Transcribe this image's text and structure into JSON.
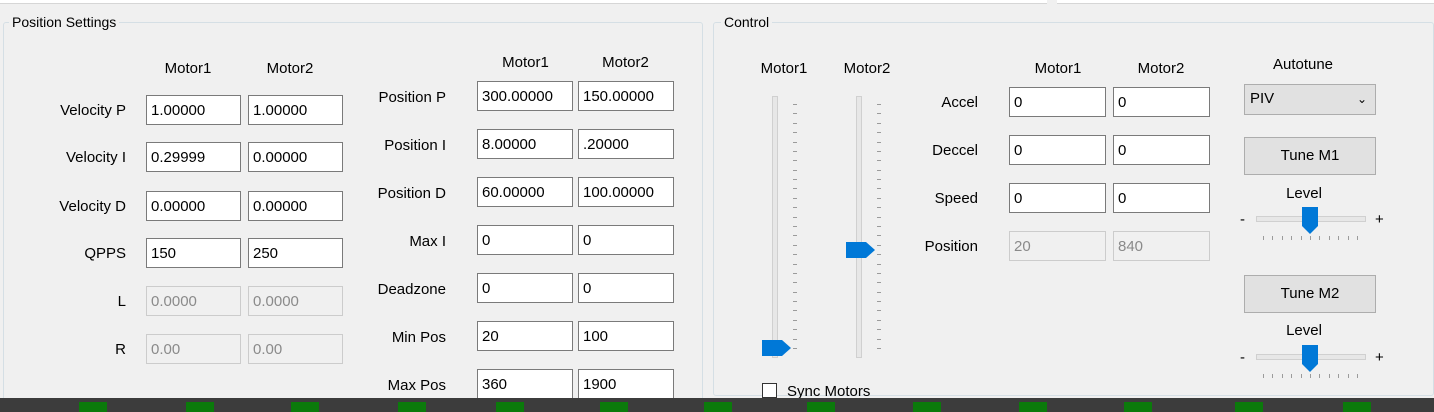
{
  "position_settings": {
    "title": "Position Settings",
    "left_headers": [
      "Motor1",
      "Motor2"
    ],
    "left_rows": [
      {
        "label": "Velocity P",
        "m1": "1.00000",
        "m2": "1.00000",
        "disabled": false
      },
      {
        "label": "Velocity I",
        "m1": "0.29999",
        "m2": "0.00000",
        "disabled": false
      },
      {
        "label": "Velocity D",
        "m1": "0.00000",
        "m2": "0.00000",
        "disabled": false
      },
      {
        "label": "QPPS",
        "m1": "150",
        "m2": "250",
        "disabled": false
      },
      {
        "label": "L",
        "m1": "0.0000",
        "m2": "0.0000",
        "disabled": true
      },
      {
        "label": "R",
        "m1": "0.00",
        "m2": "0.00",
        "disabled": true
      }
    ],
    "right_headers": [
      "Motor1",
      "Motor2"
    ],
    "right_rows": [
      {
        "label": "Position P",
        "m1": "300.00000",
        "m2": "150.00000"
      },
      {
        "label": "Position I",
        "m1": "8.00000",
        "m2": ".20000"
      },
      {
        "label": "Position D",
        "m1": "60.00000",
        "m2": "100.00000"
      },
      {
        "label": "Max I",
        "m1": "0",
        "m2": "0"
      },
      {
        "label": "Deadzone",
        "m1": "0",
        "m2": "0"
      },
      {
        "label": "Min Pos",
        "m1": "20",
        "m2": "100"
      },
      {
        "label": "Max Pos",
        "m1": "360",
        "m2": "1900"
      }
    ]
  },
  "control": {
    "title": "Control",
    "slider_labels": [
      "Motor1",
      "Motor2"
    ],
    "slider_levels": [
      0.0,
      0.4
    ],
    "headers": [
      "Motor1",
      "Motor2"
    ],
    "rows": [
      {
        "label": "Accel",
        "m1": "0",
        "m2": "0",
        "disabled": false
      },
      {
        "label": "Deccel",
        "m1": "0",
        "m2": "0",
        "disabled": false
      },
      {
        "label": "Speed",
        "m1": "0",
        "m2": "0",
        "disabled": false
      },
      {
        "label": "Position",
        "m1": "20",
        "m2": "840",
        "disabled": true
      }
    ],
    "autotune": {
      "label": "Autotune",
      "selected": "PIV",
      "tune_m1": "Tune M1",
      "tune_m2": "Tune M2",
      "level_label": "Level",
      "minus": "-",
      "plus": "+",
      "level1": 0.5,
      "level2": 0.5
    },
    "sync_label": "Sync Motors",
    "sync_checked": false
  }
}
